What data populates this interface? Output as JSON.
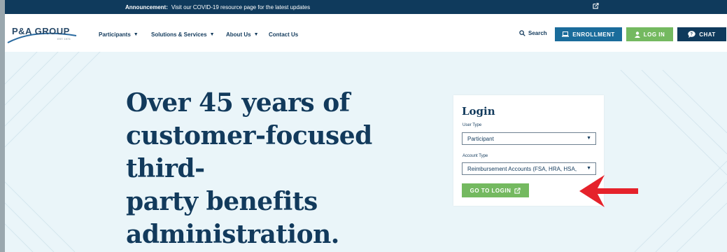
{
  "announcement": {
    "label": "Announcement:",
    "message": "Visit our COVID-19 resource page for the latest updates",
    "link_icon": "external-link-icon"
  },
  "logo": {
    "name": "P&A GROUP",
    "est": "EST. 1973"
  },
  "nav": {
    "items": [
      {
        "label": "Participants",
        "has_caret": true
      },
      {
        "label": "Solutions & Services",
        "has_caret": true
      },
      {
        "label": "About Us",
        "has_caret": true
      },
      {
        "label": "Contact Us",
        "has_caret": false
      }
    ],
    "search_label": "Search",
    "enrollment_label": "ENROLLMENT",
    "login_label": "LOG IN",
    "chat_label": "CHAT"
  },
  "hero": {
    "line1": "Over 45 years of",
    "line2": "customer-focused third-",
    "line3": "party benefits",
    "line4": "administration."
  },
  "login_card": {
    "title": "Login",
    "user_type_label": "User Type",
    "user_type_value": "Participant",
    "account_type_label": "Account Type",
    "account_type_value": "Reimbursement Accounts (FSA, HRA, HSA,",
    "go_label": "GO TO LOGIN"
  },
  "colors": {
    "navy": "#0f3a5c",
    "blue": "#1a6c9b",
    "green": "#74b960",
    "annotation_red": "#e5222b"
  }
}
